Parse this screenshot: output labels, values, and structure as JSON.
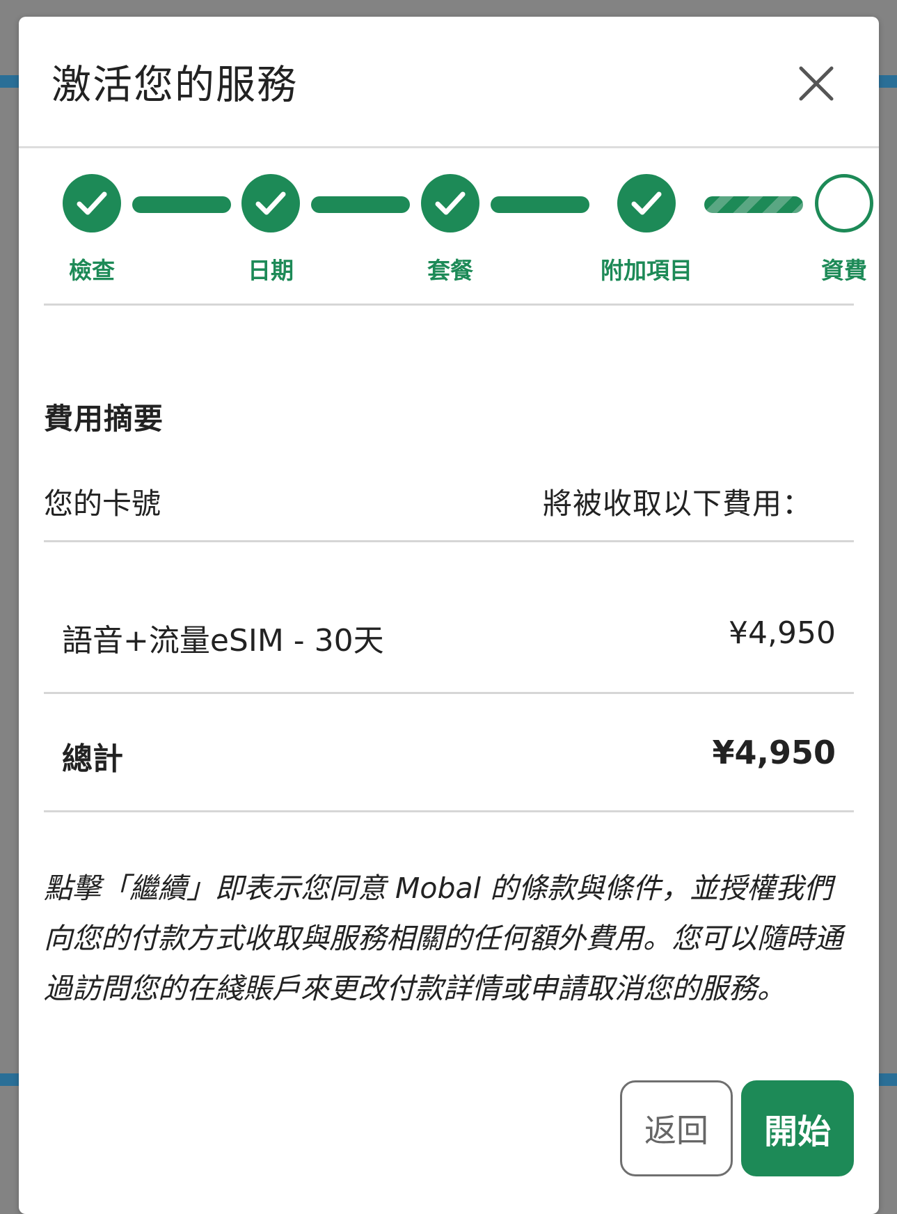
{
  "modal": {
    "title": "激活您的服務",
    "close_icon": "close-icon"
  },
  "stepper": {
    "steps": [
      {
        "label": "檢查",
        "status": "complete"
      },
      {
        "label": "日期",
        "status": "complete"
      },
      {
        "label": "套餐",
        "status": "complete"
      },
      {
        "label": "附加項目",
        "status": "complete"
      },
      {
        "label": "資費",
        "status": "current"
      }
    ]
  },
  "summary": {
    "title": "費用摘要",
    "card_label": "您的卡號",
    "charge_label": "將被收取以下費用：",
    "items": [
      {
        "name": "語音+流量eSIM - 30天",
        "price": "¥4,950"
      }
    ],
    "total_label": "總計",
    "total_price": "¥4,950"
  },
  "terms": {
    "text": "點擊「繼續」即表示您同意 Mobal 的條款與條件，並授權我們向您的付款方式收取與服務相關的任何額外費用。您可以隨時通過訪問您的在綫賬戶來更改付款詳情或申請取消您的服務。"
  },
  "buttons": {
    "back_label": "返回",
    "start_label": "開始"
  },
  "colors": {
    "accent": "#1d8a57",
    "overlay": "#838383",
    "text": "#222222"
  }
}
